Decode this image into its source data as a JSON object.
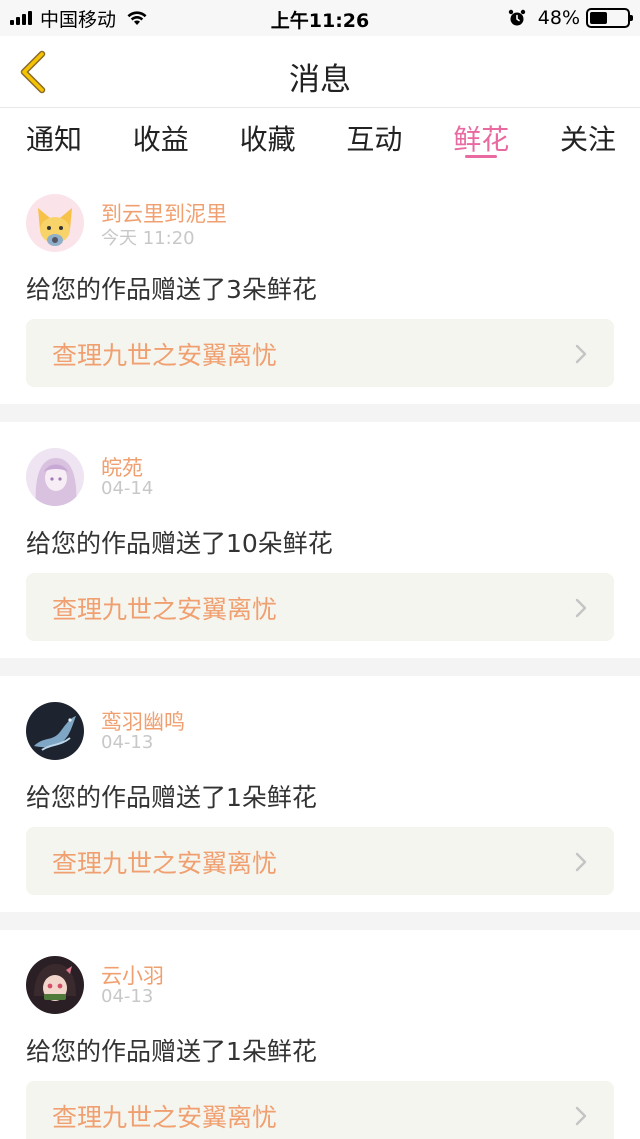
{
  "status_bar": {
    "carrier": "中国移动",
    "time": "上午11:26",
    "battery": "48%",
    "battery_level": 0.48
  },
  "nav": {
    "title": "消息",
    "back_icon": "back-chevron-icon"
  },
  "tabs": [
    {
      "label": "通知",
      "active": false
    },
    {
      "label": "收益",
      "active": false
    },
    {
      "label": "收藏",
      "active": false
    },
    {
      "label": "互动",
      "active": false
    },
    {
      "label": "鲜花",
      "active": true
    },
    {
      "label": "关注",
      "active": false
    }
  ],
  "colors": {
    "accent_tab": "#e86aa0",
    "username": "#f0a070",
    "link_text": "#f0a070",
    "link_bg": "#f5f5ef"
  },
  "items": [
    {
      "username": "到云里到泥里",
      "date": "今天 11:20",
      "message": "给您的作品赠送了3朵鲜花",
      "work": "查理九世之安翼离忧"
    },
    {
      "username": "皖苑",
      "date": "04-14",
      "message": "给您的作品赠送了10朵鲜花",
      "work": "查理九世之安翼离忧"
    },
    {
      "username": "鸾羽幽鸣",
      "date": "04-13",
      "message": "给您的作品赠送了1朵鲜花",
      "work": "查理九世之安翼离忧"
    },
    {
      "username": "云小羽",
      "date": "04-13",
      "message": "给您的作品赠送了1朵鲜花",
      "work": "查理九世之安翼离忧"
    }
  ]
}
